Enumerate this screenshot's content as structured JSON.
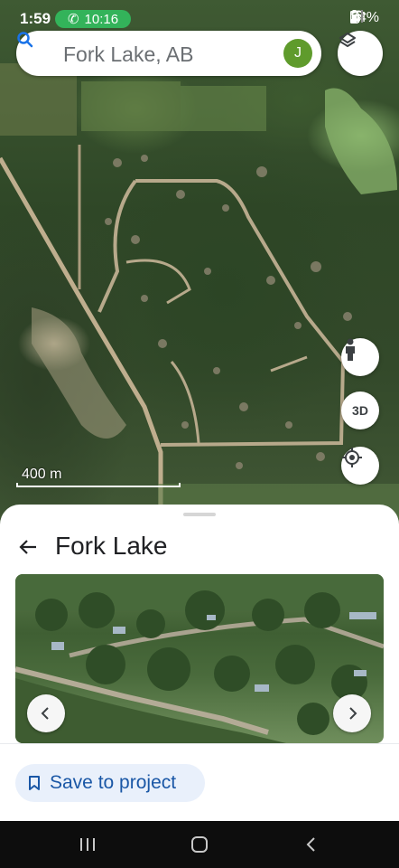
{
  "status_bar": {
    "time": "1:59",
    "call_duration": "10:16",
    "battery": "74%"
  },
  "search": {
    "query": "Fork Lake, AB",
    "avatar_initial": "J"
  },
  "map": {
    "fab_3d_label": "3D",
    "scale_label": "400 m"
  },
  "place": {
    "title": "Fork Lake",
    "save_label": "Save to project"
  },
  "colors": {
    "accent_blue": "#1a57a6",
    "call_green": "#33b35a",
    "avatar_green": "#5f9b2c"
  },
  "icons": [
    "search-icon",
    "layers-icon",
    "person-icon",
    "locate-icon",
    "back-arrow-icon",
    "chevron-left-icon",
    "chevron-right-icon",
    "bookmark-icon",
    "recents-icon",
    "home-icon",
    "nav-back-icon"
  ]
}
